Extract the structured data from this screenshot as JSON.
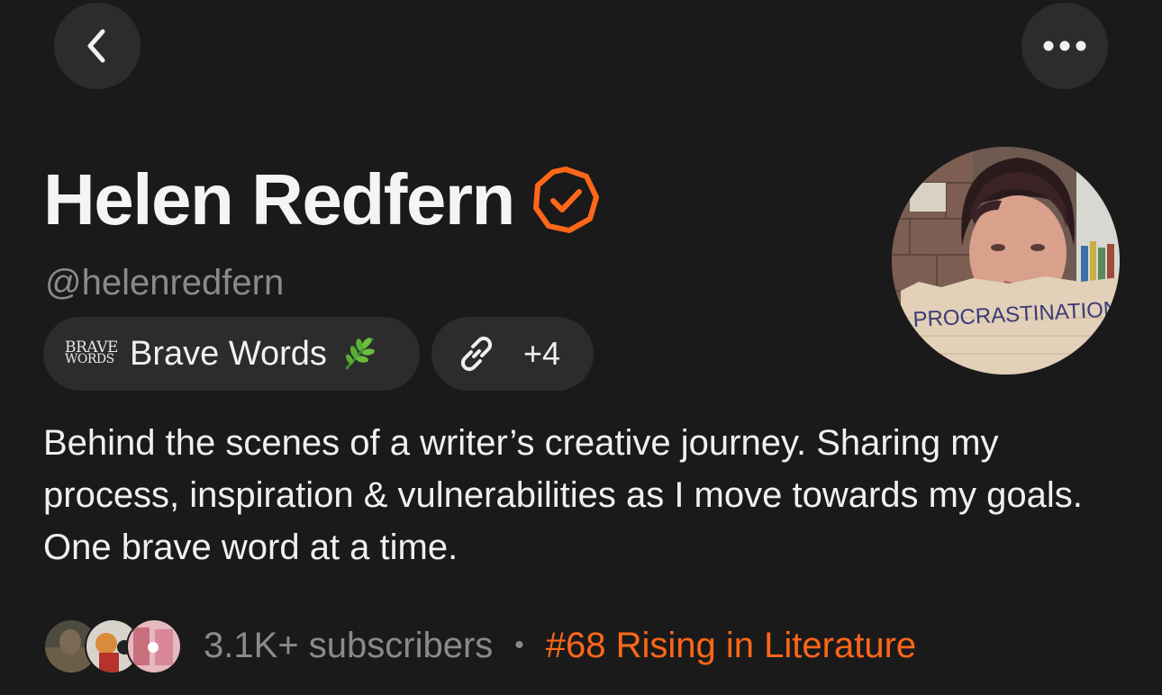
{
  "header": {
    "back_icon": "chevron-left-icon",
    "more_icon": "ellipsis-icon"
  },
  "profile": {
    "name": "Helen Redfern",
    "verified_icon": "verified-badge-icon",
    "handle": "@helenredfern",
    "accent_color": "#ff6719",
    "avatar_caption": "PROCRASTINATION"
  },
  "publication": {
    "logo_line1": "BRAVE",
    "logo_line2": "WORDS",
    "name": "Brave Words",
    "emoji_icon": "herb-icon"
  },
  "links": {
    "icon": "link-icon",
    "count": "+4"
  },
  "bio": "Behind the scenes of a writer’s creative journey. Sharing my process, inspiration & vulnerabilities as I move towards my goals. One brave word at a time.",
  "stats": {
    "subscribers": "3.1K+ subscribers",
    "separator": "•",
    "ranking": "#68 Rising in Literature"
  }
}
